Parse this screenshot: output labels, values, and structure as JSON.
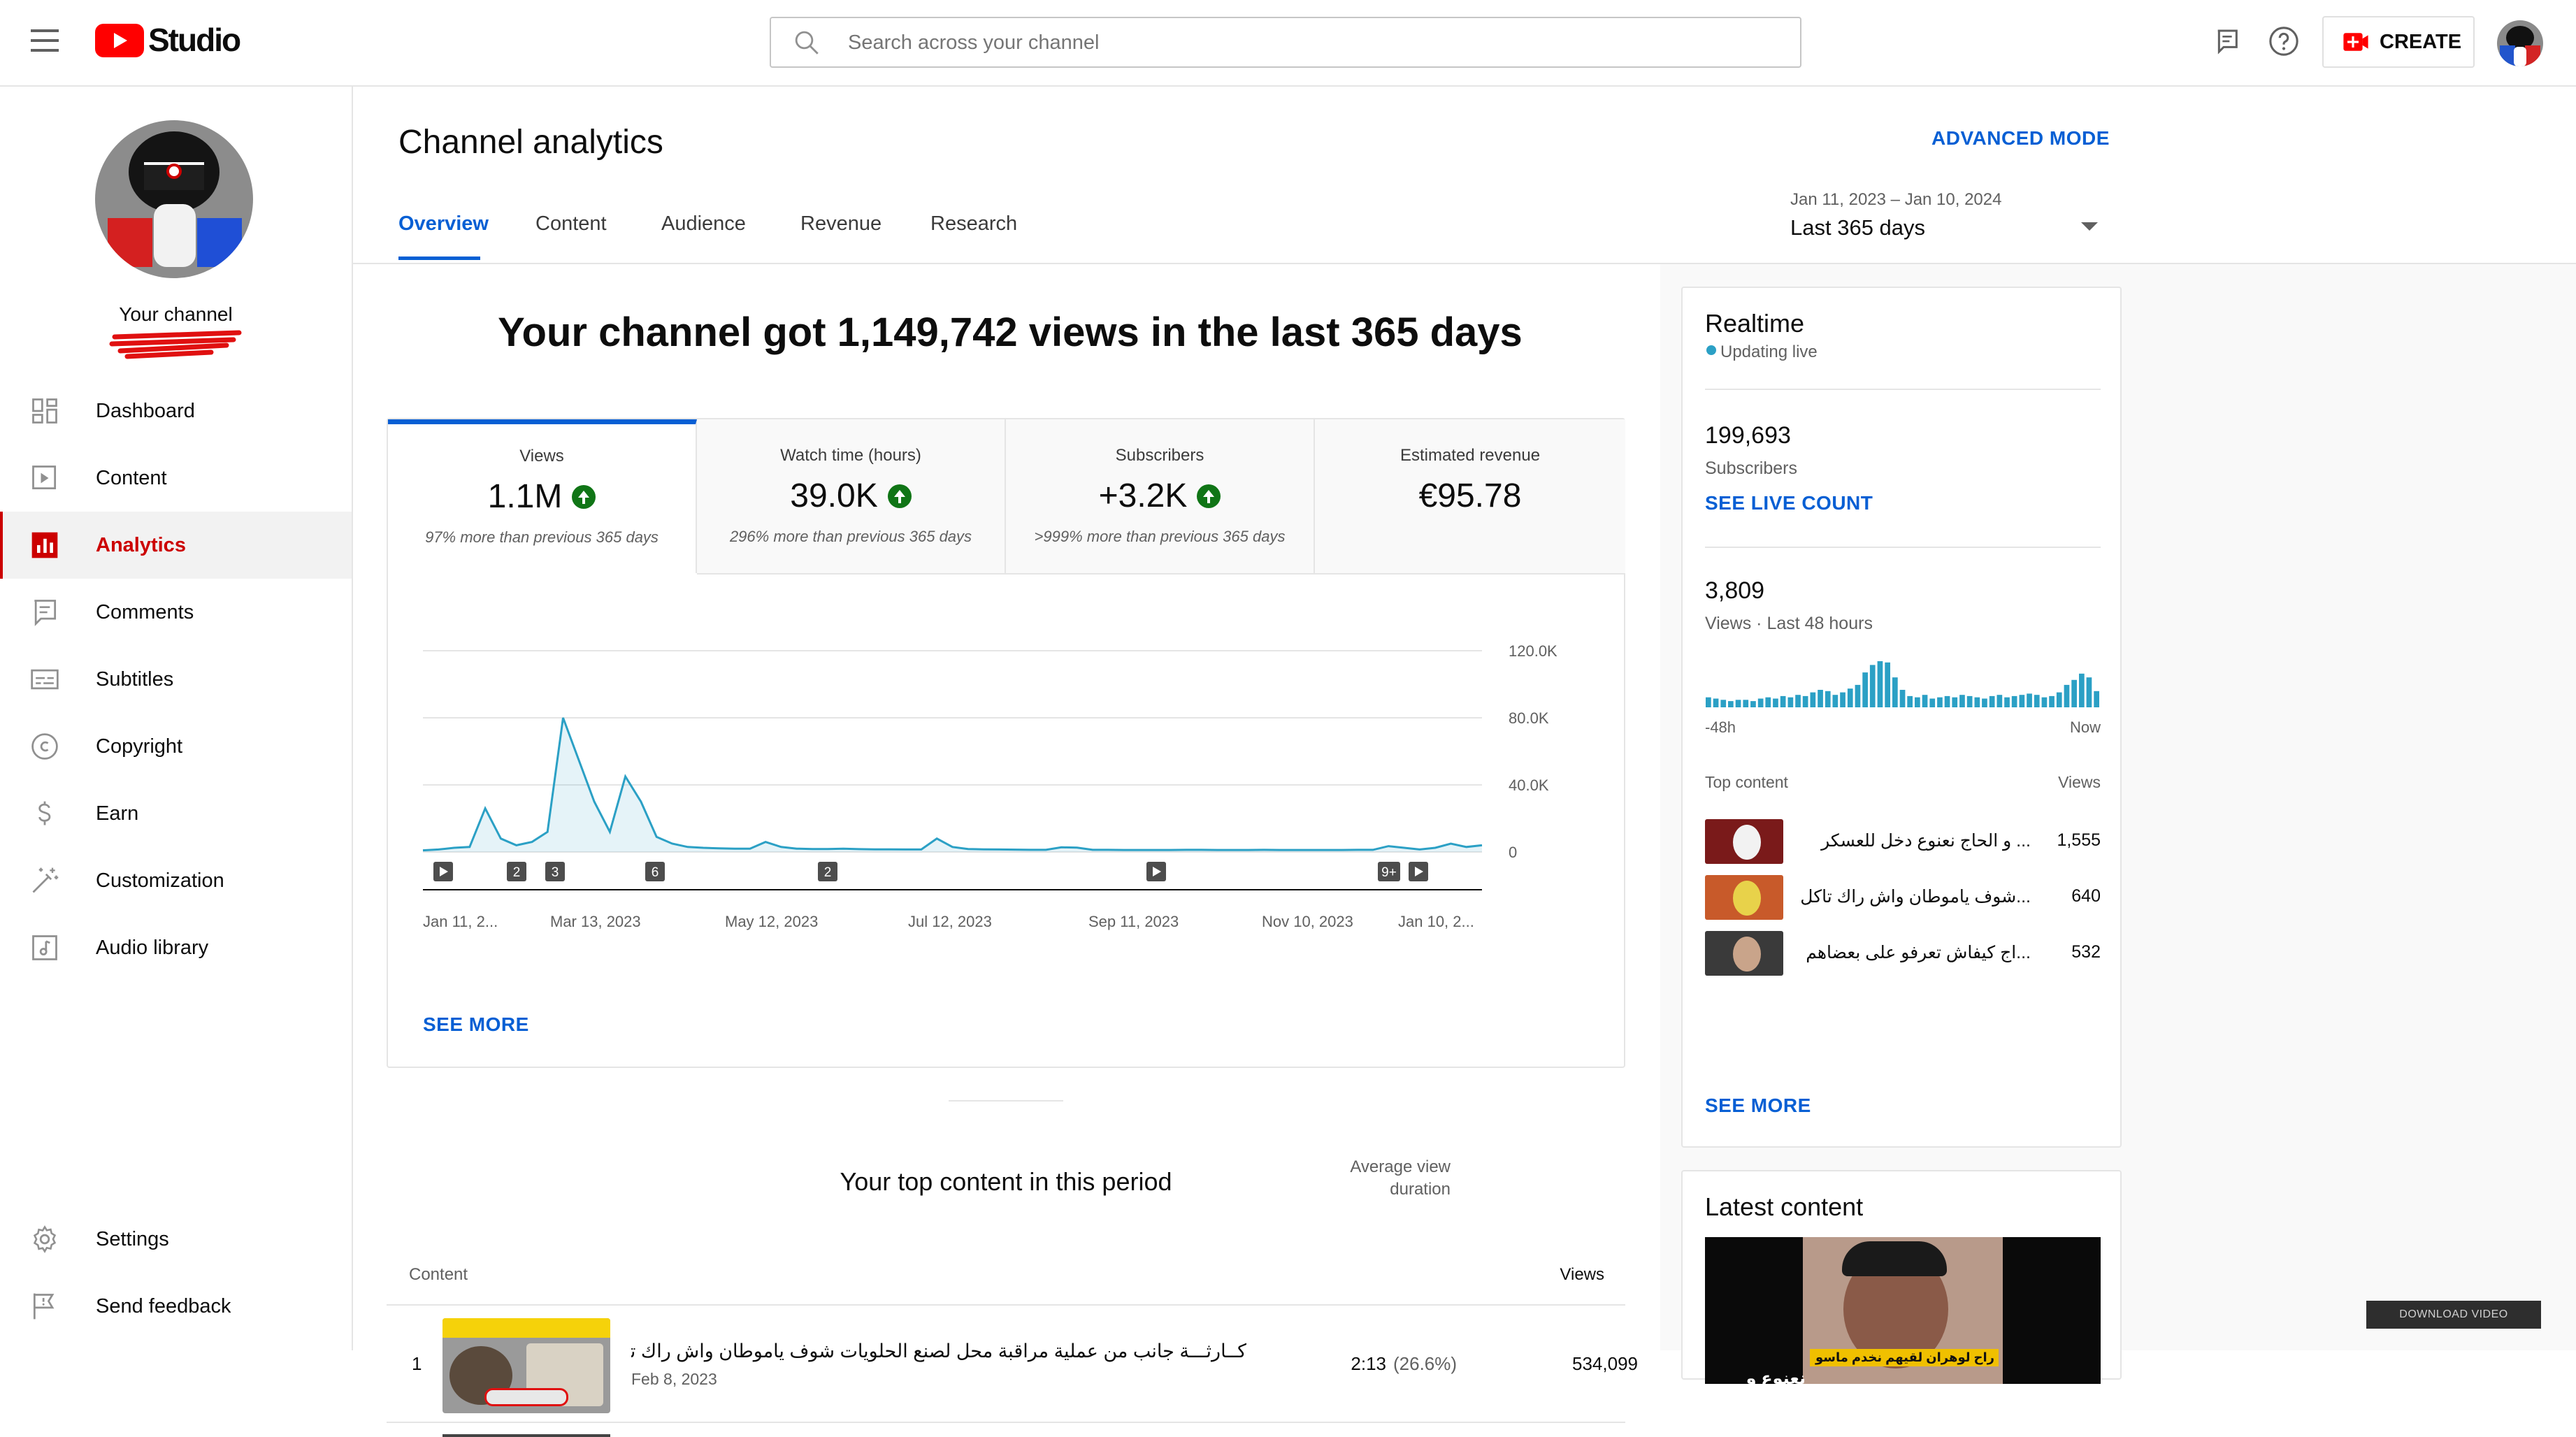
{
  "app": {
    "logo_text": "Studio"
  },
  "search": {
    "placeholder": "Search across your channel"
  },
  "header": {
    "create_label": "CREATE"
  },
  "channel": {
    "label": "Your channel"
  },
  "sidebar": {
    "items": [
      {
        "label": "Dashboard",
        "icon": "dashboard-icon"
      },
      {
        "label": "Content",
        "icon": "content-icon"
      },
      {
        "label": "Analytics",
        "icon": "analytics-icon"
      },
      {
        "label": "Comments",
        "icon": "comments-icon"
      },
      {
        "label": "Subtitles",
        "icon": "subtitles-icon"
      },
      {
        "label": "Copyright",
        "icon": "copyright-icon"
      },
      {
        "label": "Earn",
        "icon": "earn-icon"
      },
      {
        "label": "Customization",
        "icon": "customization-icon"
      },
      {
        "label": "Audio library",
        "icon": "audio-library-icon"
      }
    ],
    "bottom": [
      {
        "label": "Settings",
        "icon": "settings-icon"
      },
      {
        "label": "Send feedback",
        "icon": "feedback-icon"
      }
    ]
  },
  "page": {
    "title": "Channel analytics",
    "advanced_mode": "ADVANCED MODE",
    "tabs": [
      "Overview",
      "Content",
      "Audience",
      "Revenue",
      "Research"
    ],
    "date_range": "Jan 11, 2023 – Jan 10, 2024",
    "date_label": "Last 365 days"
  },
  "summary": {
    "headline": "Your channel got 1,149,742 views in the last 365 days"
  },
  "metrics": [
    {
      "title": "Views",
      "value": "1.1M",
      "sub": "97% more than previous 365 days"
    },
    {
      "title": "Watch time (hours)",
      "value": "39.0K",
      "sub": "296% more than previous 365 days"
    },
    {
      "title": "Subscribers",
      "value": "+3.2K",
      "sub": ">999% more than previous 365 days"
    },
    {
      "title": "Estimated revenue",
      "value": "€95.78",
      "sub": ""
    }
  ],
  "chart": {
    "y_ticks": [
      "120.0K",
      "80.0K",
      "40.0K",
      "0"
    ],
    "x_ticks": [
      "Jan 11, 2...",
      "Mar 13, 2023",
      "May 12, 2023",
      "Jul 12, 2023",
      "Sep 11, 2023",
      "Nov 10, 2023",
      "Jan 10, 2..."
    ],
    "markers": [
      "",
      "2",
      "3",
      "6",
      "2",
      "",
      "9+",
      ""
    ],
    "see_more": "SEE MORE"
  },
  "chart_data": {
    "type": "area",
    "series": [
      {
        "values": [
          1000,
          1500,
          2500,
          3000,
          26000,
          8000,
          4000,
          6000,
          12000,
          80000,
          55000,
          30000,
          12000,
          45000,
          30000,
          9000,
          5000,
          3000,
          2500,
          2200,
          2000,
          2000,
          6000,
          3000,
          2000,
          1800,
          1800,
          2000,
          1700,
          1600,
          1600,
          1500,
          1500,
          8000,
          3000,
          1800,
          1600,
          1500,
          1400,
          1300,
          1300,
          2800,
          2600,
          1300,
          1300,
          1200,
          1200,
          1200,
          1200,
          1300,
          1300,
          1200,
          1200,
          1200,
          1300,
          1200,
          1200,
          1200,
          1200,
          1200,
          1300,
          1300,
          3500,
          2500,
          1500,
          2500,
          5000,
          3000,
          4000
        ]
      }
    ],
    "x": [
      "2023-01-11",
      "2024-01-10"
    ],
    "ylim": [
      0,
      120000
    ],
    "grid": true
  },
  "top_content": {
    "title": "Your top content in this period",
    "col_content": "Content",
    "col_avd": "Average view duration",
    "col_views": "Views",
    "rows": [
      {
        "rank": "1",
        "title": "كــارثـــة جانب من عملية مراقبة محل لصنع الحلويات شوف ياموطان واش راك تاكل",
        "date": "Feb 8, 2023",
        "duration": "2:13",
        "pct": "(26.6%)",
        "views": "534,099"
      }
    ]
  },
  "realtime": {
    "title": "Realtime",
    "status": "Updating live",
    "subs_value": "199,693",
    "subs_label": "Subscribers",
    "see_live": "SEE LIVE COUNT",
    "views_value": "3,809",
    "views_label": "Views · Last 48 hours",
    "axis_start": "-48h",
    "axis_end": "Now",
    "top_label": "Top content",
    "top_views_label": "Views",
    "items": [
      {
        "title": "... و الحاج نعنوع دخل للعسكر",
        "views": "1,555"
      },
      {
        "title": "...شوف ياموطان واش راك تاكل",
        "views": "640"
      },
      {
        "title": "...اج كيفاش تعرفو على بعضاهم",
        "views": "532"
      }
    ],
    "see_more": "SEE MORE",
    "bars": [
      8,
      7,
      6,
      5,
      6,
      6,
      5,
      7,
      8,
      7,
      9,
      8,
      10,
      9,
      12,
      14,
      13,
      10,
      12,
      15,
      18,
      28,
      34,
      37,
      36,
      24,
      14,
      9,
      8,
      10,
      7,
      8,
      9,
      8,
      10,
      9,
      8,
      7,
      9,
      10,
      8,
      9,
      10,
      11,
      10,
      8,
      9,
      12,
      18,
      22,
      27,
      24,
      13
    ]
  },
  "latest": {
    "title": "Latest content",
    "thumb_text": "راح لوهران لقيهم نخدم ماسو",
    "thumb_text2": "نعنوع و الحاج"
  },
  "download": {
    "label": "DOWNLOAD VIDEO"
  },
  "colors": {
    "accent": "#065fd4",
    "brand": "#ff0000",
    "chart": "#2ba0c5"
  }
}
